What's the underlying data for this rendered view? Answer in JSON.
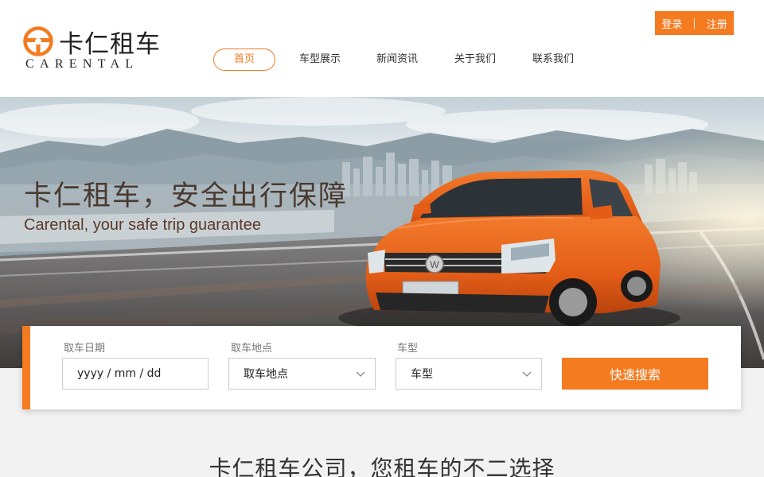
{
  "brand": {
    "name_cn": "卡仁租车",
    "name_en": "CARENTAL"
  },
  "auth": {
    "login": "登录",
    "separator": "|",
    "register": "注册"
  },
  "nav": {
    "items": [
      {
        "label": "首页",
        "active": true
      },
      {
        "label": "车型展示",
        "active": false
      },
      {
        "label": "新闻资讯",
        "active": false
      },
      {
        "label": "关于我们",
        "active": false
      },
      {
        "label": "联系我们",
        "active": false
      }
    ]
  },
  "hero": {
    "title": "卡仁租车，安全出行保障",
    "subtitle": "Carental, your safe trip guarantee"
  },
  "search": {
    "date_label": "取车日期",
    "date_value": "yyyy / mm / dd",
    "location_label": "取车地点",
    "location_value": "取车地点",
    "model_label": "车型",
    "model_value": "车型",
    "button": "快速搜索"
  },
  "section": {
    "title": "卡仁租车公司，您租车的不二选择"
  },
  "colors": {
    "accent": "#f47b20",
    "car": "#e8621c"
  },
  "icons": {
    "logo": "steering-wheel-icon",
    "dropdown": "chevron-down-icon"
  }
}
